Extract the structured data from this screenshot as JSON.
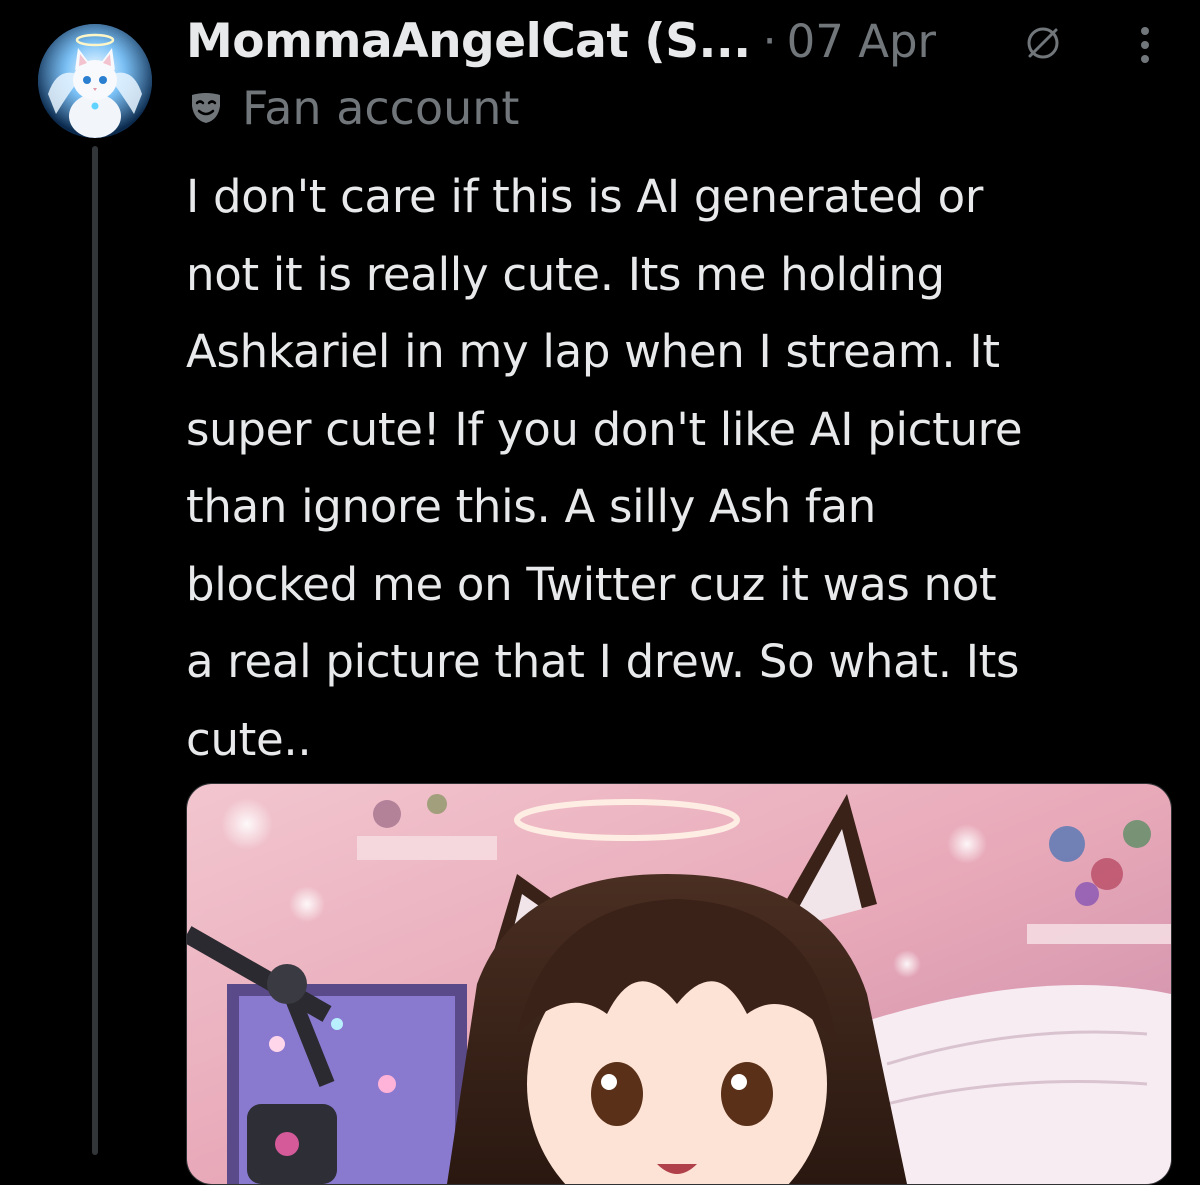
{
  "author": {
    "display_name": "MommaAngelCat (S...",
    "separator": "·",
    "date": "07 Apr",
    "label": "Fan account"
  },
  "icons": {
    "avatar": "angel-cat-avatar",
    "pin": "ban-icon",
    "more": "more-vertical-icon",
    "label": "mask-icon"
  },
  "tweet": {
    "lines": [
      "I don't care if this is AI generated or",
      "not it is really cute. Its me holding",
      "Ashkariel in my lap when I stream. It",
      "super cute! If you don't like AI picture",
      "than ignore this. A silly Ash fan",
      "blocked me on Twitter cuz it was not",
      "a real picture that I drew. So what. Its",
      "cute.."
    ]
  },
  "colors": {
    "background": "#000000",
    "primary_text": "#e7e9ea",
    "secondary_text": "#71767b",
    "thread_line": "#333639"
  }
}
